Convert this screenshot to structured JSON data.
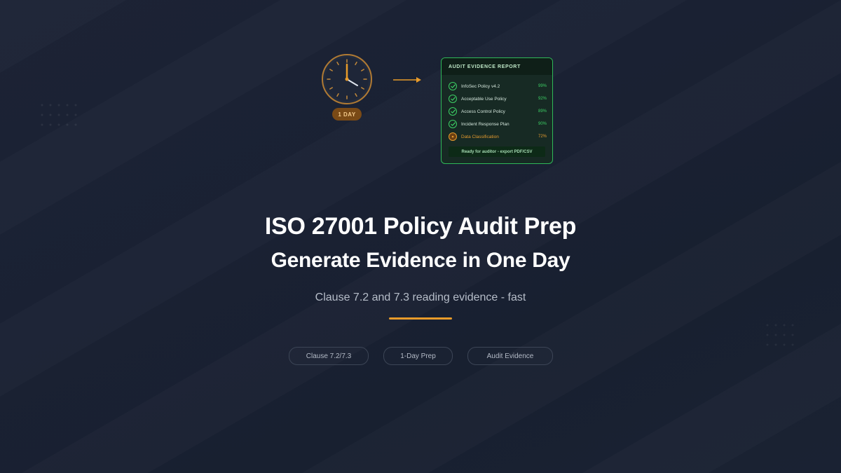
{
  "hero": {
    "clock_badge": "1 DAY",
    "report": {
      "title": "AUDIT EVIDENCE REPORT",
      "items": [
        {
          "label": "InfoSec Policy v4.2",
          "value": "99%",
          "status": "ok"
        },
        {
          "label": "Acceptable Use Policy",
          "value": "92%",
          "status": "ok"
        },
        {
          "label": "Access Control Policy",
          "value": "89%",
          "status": "ok"
        },
        {
          "label": "Incident Response Plan",
          "value": "90%",
          "status": "ok"
        },
        {
          "label": "Data Classification",
          "value": "72%",
          "status": "warn"
        }
      ],
      "footer": "Ready for auditor - export PDF/CSV"
    }
  },
  "headline": "ISO 27001 Policy Audit Prep",
  "subheadline": "Generate Evidence in One Day",
  "tagline": "Clause 7.2 and 7.3 reading evidence - fast",
  "tags": [
    "Clause 7.2/7.3",
    "1-Day Prep",
    "Audit Evidence"
  ],
  "colors": {
    "accent": "#e89b2a",
    "success": "#3ccf64",
    "warning": "#e39a2e",
    "background": "#1b2234"
  }
}
